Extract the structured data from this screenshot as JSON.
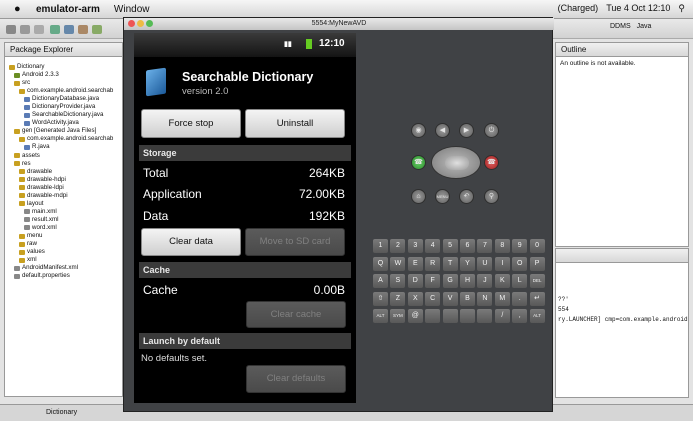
{
  "menubar": {
    "apple": "",
    "app": "emulator-arm",
    "window": "Window",
    "status": "(Charged)",
    "clock": "Tue 4 Oct  12:10"
  },
  "eclipse": {
    "package_explorer": "Package Explorer",
    "tree": [
      {
        "label": "Dictionary",
        "indent": 0,
        "color": "#c8a020"
      },
      {
        "label": "Android 2.3.3",
        "indent": 1,
        "color": "#6b8e23"
      },
      {
        "label": "src",
        "indent": 1,
        "color": "#c8a020"
      },
      {
        "label": "com.example.android.searchab",
        "indent": 2,
        "color": "#c8a020"
      },
      {
        "label": "DictionaryDatabase.java",
        "indent": 3,
        "color": "#5a7bb5"
      },
      {
        "label": "DictionaryProvider.java",
        "indent": 3,
        "color": "#5a7bb5"
      },
      {
        "label": "SearchableDictionary.java",
        "indent": 3,
        "color": "#5a7bb5"
      },
      {
        "label": "WordActivity.java",
        "indent": 3,
        "color": "#5a7bb5"
      },
      {
        "label": "gen [Generated Java Files]",
        "indent": 1,
        "color": "#c8a020"
      },
      {
        "label": "com.example.android.searchab",
        "indent": 2,
        "color": "#c8a020"
      },
      {
        "label": "R.java",
        "indent": 3,
        "color": "#5a7bb5"
      },
      {
        "label": "assets",
        "indent": 1,
        "color": "#c8a020"
      },
      {
        "label": "res",
        "indent": 1,
        "color": "#c8a020"
      },
      {
        "label": "drawable",
        "indent": 2,
        "color": "#c8a020"
      },
      {
        "label": "drawable-hdpi",
        "indent": 2,
        "color": "#c8a020"
      },
      {
        "label": "drawable-ldpi",
        "indent": 2,
        "color": "#c8a020"
      },
      {
        "label": "drawable-mdpi",
        "indent": 2,
        "color": "#c8a020"
      },
      {
        "label": "layout",
        "indent": 2,
        "color": "#c8a020"
      },
      {
        "label": "main.xml",
        "indent": 3,
        "color": "#888"
      },
      {
        "label": "result.xml",
        "indent": 3,
        "color": "#888"
      },
      {
        "label": "word.xml",
        "indent": 3,
        "color": "#888"
      },
      {
        "label": "menu",
        "indent": 2,
        "color": "#c8a020"
      },
      {
        "label": "raw",
        "indent": 2,
        "color": "#c8a020"
      },
      {
        "label": "values",
        "indent": 2,
        "color": "#c8a020"
      },
      {
        "label": "xml",
        "indent": 2,
        "color": "#c8a020"
      },
      {
        "label": "AndroidManifest.xml",
        "indent": 1,
        "color": "#888"
      },
      {
        "label": "default.properties",
        "indent": 1,
        "color": "#888"
      }
    ],
    "outline_title": "Outline",
    "outline_msg": "An outline is not available.",
    "perspective": "DDMS",
    "perspective2": "Java",
    "console_lines": [
      "??'",
      "554",
      "ry.LAUNCHER] cmp=com.example.android"
    ],
    "status_text": "Dictionary"
  },
  "emulator": {
    "title": "5554:MyNewAVD",
    "time": "12:10",
    "app_name": "Searchable Dictionary",
    "version": "version 2.0",
    "force_stop": "Force stop",
    "uninstall": "Uninstall",
    "storage": "Storage",
    "rows": [
      {
        "label": "Total",
        "value": "264KB"
      },
      {
        "label": "Application",
        "value": "72.00KB"
      },
      {
        "label": "Data",
        "value": "192KB"
      }
    ],
    "clear_data": "Clear data",
    "move_sd": "Move to SD card",
    "cache_header": "Cache",
    "cache_label": "Cache",
    "cache_value": "0.00B",
    "clear_cache": "Clear cache",
    "launch_header": "Launch by default",
    "no_defaults": "No defaults set.",
    "clear_defaults": "Clear defaults",
    "menu_label": "MENU"
  },
  "keyboard": [
    [
      "1",
      "2",
      "3",
      "4",
      "5",
      "6",
      "7",
      "8",
      "9",
      "0"
    ],
    [
      "Q",
      "W",
      "E",
      "R",
      "T",
      "Y",
      "U",
      "I",
      "O",
      "P"
    ],
    [
      "A",
      "S",
      "D",
      "F",
      "G",
      "H",
      "J",
      "K",
      "L",
      "DEL"
    ],
    [
      "⇧",
      "Z",
      "X",
      "C",
      "V",
      "B",
      "N",
      "M",
      ".",
      "↵"
    ],
    [
      "ALT",
      "SYM",
      "@",
      "",
      "",
      "",
      "",
      "/",
      ",",
      "ALT"
    ]
  ]
}
